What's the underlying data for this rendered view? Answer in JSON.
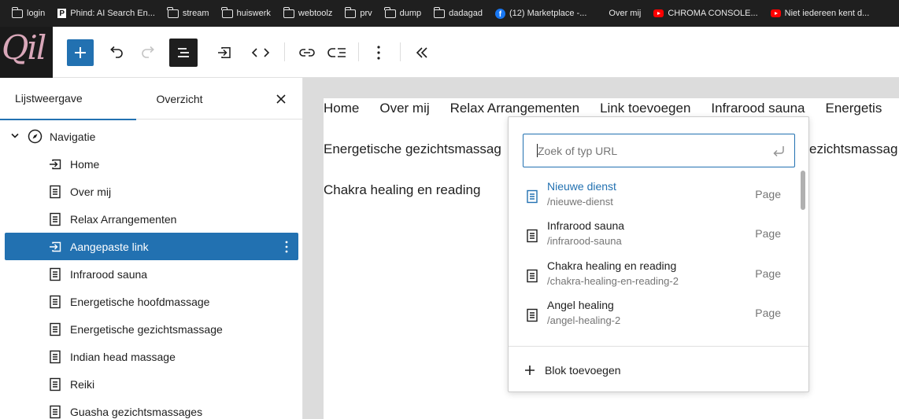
{
  "bookmarks": [
    {
      "label": "login",
      "icon": "folder-icon"
    },
    {
      "label": "Phind: AI Search En...",
      "icon": "phind-icon"
    },
    {
      "label": "stream",
      "icon": "folder-icon"
    },
    {
      "label": "huiswerk",
      "icon": "folder-icon"
    },
    {
      "label": "webtoolz",
      "icon": "folder-icon"
    },
    {
      "label": "prv",
      "icon": "folder-icon"
    },
    {
      "label": "dump",
      "icon": "folder-icon"
    },
    {
      "label": "dadagad",
      "icon": "folder-icon"
    },
    {
      "label": "(12) Marketplace -...",
      "icon": "facebook-icon"
    },
    {
      "label": "Over mij",
      "icon": "none"
    },
    {
      "label": "CHROMA CONSOLE...",
      "icon": "youtube-icon"
    },
    {
      "label": "Niet iedereen kent d...",
      "icon": "youtube-icon"
    }
  ],
  "logo": {
    "text": "Qil"
  },
  "sidebar": {
    "tabs": [
      "Lijstweergave",
      "Overzicht"
    ],
    "root": "Navigatie",
    "items": [
      {
        "label": "Home",
        "icon": "custom-link-icon"
      },
      {
        "label": "Over mij",
        "icon": "page-icon"
      },
      {
        "label": "Relax Arrangementen",
        "icon": "page-icon"
      },
      {
        "label": "Aangepaste link",
        "icon": "custom-link-icon",
        "selected": true
      },
      {
        "label": "Infrarood sauna",
        "icon": "page-icon"
      },
      {
        "label": "Energetische hoofdmassage",
        "icon": "page-icon"
      },
      {
        "label": "Energetische gezichtsmassage",
        "icon": "page-icon"
      },
      {
        "label": "Indian head massage",
        "icon": "page-icon"
      },
      {
        "label": "Reiki",
        "icon": "page-icon"
      },
      {
        "label": "Guasha gezichtsmassages",
        "icon": "page-icon"
      }
    ]
  },
  "canvas": {
    "line1": [
      "Home",
      "Over mij",
      "Relax Arrangementen",
      "Link toevoegen",
      "Infrarood sauna",
      "Energetis"
    ],
    "line2_left": "Energetische gezichtsmassag",
    "line2_right": "ezichtsmassag",
    "line3": "Chakra healing en reading"
  },
  "popover": {
    "placeholder": "Zoek of typ URL",
    "suggestions": [
      {
        "title": "Nieuwe dienst",
        "url": "/nieuwe-dienst",
        "kind": "Page"
      },
      {
        "title": "Infrarood sauna",
        "url": "/infrarood-sauna",
        "kind": "Page"
      },
      {
        "title": "Chakra healing en reading",
        "url": "/chakra-healing-en-reading-2",
        "kind": "Page"
      },
      {
        "title": "Angel healing",
        "url": "/angel-healing-2",
        "kind": "Page"
      }
    ],
    "add_block": "Blok toevoegen"
  },
  "colors": {
    "accent": "#2271b1",
    "logo_bg": "#1a1a1a",
    "bookmarks_bg": "#1f1f1f",
    "canvas_bg": "#dcdcdc"
  }
}
